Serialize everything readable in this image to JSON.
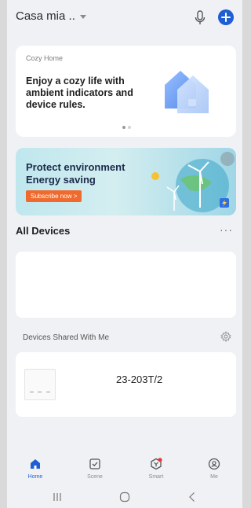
{
  "header": {
    "home_name": "Casa mia .."
  },
  "cozy_card": {
    "kicker": "Cozy Home",
    "text": "Enjoy a cozy life with ambient indicators and device rules."
  },
  "banner": {
    "title": "Protect environment Energy saving",
    "button": "Subscribe now >"
  },
  "all_devices": {
    "title": "All Devices",
    "more": "···"
  },
  "shared": {
    "title": "Devices Shared With Me",
    "devices": [
      {
        "name": "23-203T/2"
      }
    ]
  },
  "tabs": [
    {
      "label": "Home",
      "icon": "home-icon",
      "active": true
    },
    {
      "label": "Scene",
      "icon": "scene-checkbox-icon",
      "active": false
    },
    {
      "label": "Smart",
      "icon": "smart-icon",
      "active": false
    },
    {
      "label": "Me",
      "icon": "profile-icon",
      "active": false
    }
  ],
  "colors": {
    "accent": "#1f5fd1",
    "banner_button": "#f06a2d",
    "notification_dot": "#e53935",
    "background": "#f0f1f5"
  }
}
